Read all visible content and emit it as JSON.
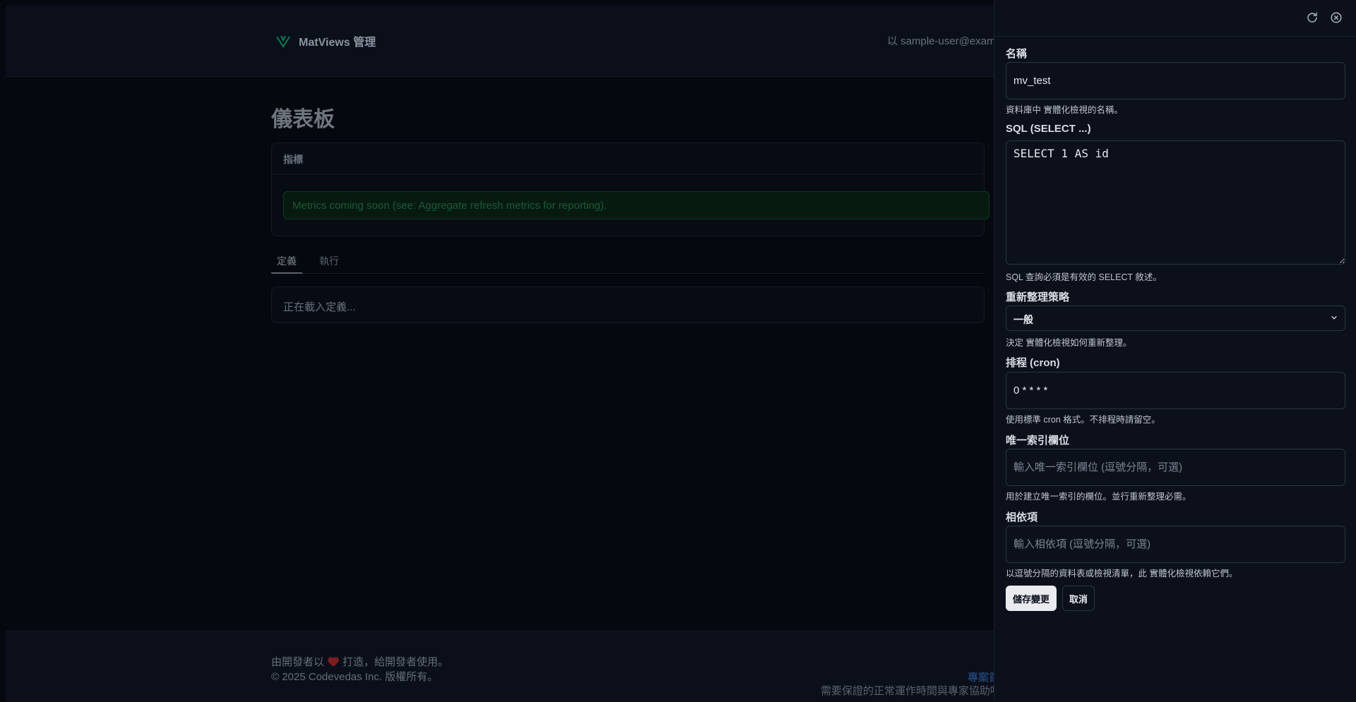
{
  "header": {
    "brand_name": "MatViews 管理",
    "login_info": "以 sample-user@examp"
  },
  "page": {
    "title": "儀表板",
    "metrics": {
      "heading": "指標",
      "alert": "Metrics coming soon (see: Aggregate refresh metrics for reporting)."
    },
    "tabs": [
      {
        "label": "定義",
        "active": true
      },
      {
        "label": "執行",
        "active": false
      }
    ],
    "definition_loading": "正在載入定義..."
  },
  "footer": {
    "line1_prefix": "由開發者以",
    "line1_suffix": "打造，給開發者使用。",
    "line2": "© 2025 Codevedas Inc. 版權所有。",
    "link": "專案首",
    "subtext": "需要保證的正常運作時間與專家協助嗎"
  },
  "drawer": {
    "icons": {
      "refresh": "refresh-icon",
      "close": "close-circle-icon"
    },
    "name": {
      "label": "名稱",
      "value": "mv_test",
      "help": "資料庫中 實體化檢視的名稱。"
    },
    "sql": {
      "label": "SQL (SELECT ...)",
      "value": "SELECT 1 AS id",
      "help": "SQL 查詢必須是有效的 SELECT 敘述。"
    },
    "strategy": {
      "label": "重新整理策略",
      "selected": "一般",
      "help": "決定 實體化檢視如何重新整理。"
    },
    "schedule": {
      "label": "排程 (cron)",
      "value": "0 * * * *",
      "help": "使用標準 cron 格式。不排程時請留空。"
    },
    "unique_index": {
      "label": "唯一索引欄位",
      "placeholder": "輸入唯一索引欄位 (逗號分隔，可選)",
      "value": "",
      "help": "用於建立唯一索引的欄位。並行重新整理必需。"
    },
    "dependencies": {
      "label": "相依項",
      "placeholder": "輸入相依項 (逗號分隔，可選)",
      "value": "",
      "help": "以逗號分隔的資料表或檢視清單，此 實體化檢視依賴它們。"
    },
    "save_label": "儲存變更",
    "cancel_label": "取消"
  },
  "colors": {
    "background": "#05080f",
    "drawer_bg": "#0b101b",
    "accent_green": "#10b981",
    "heart": "#e53e3e"
  }
}
